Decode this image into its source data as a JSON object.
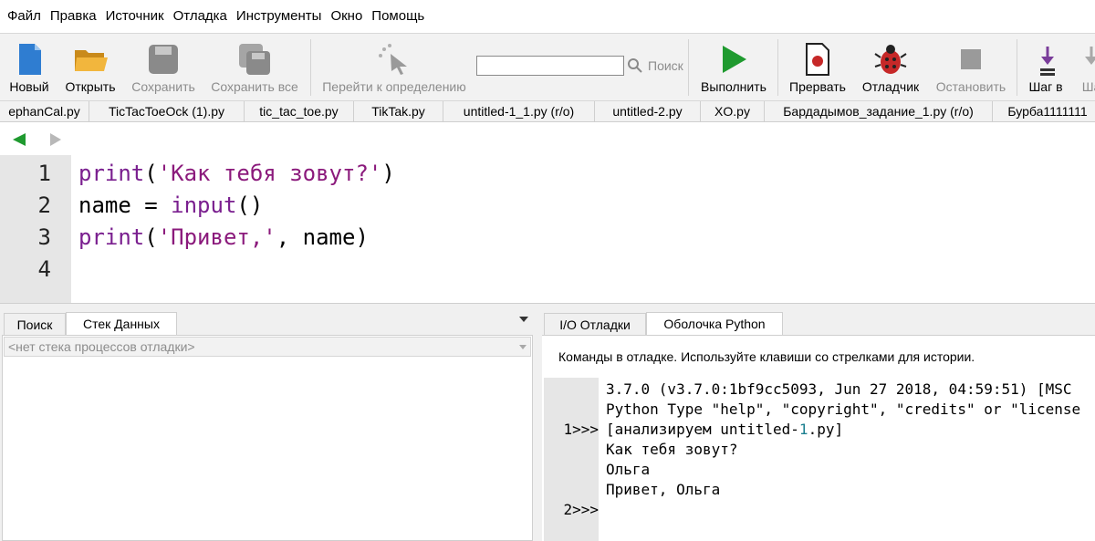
{
  "menu": [
    "Файл",
    "Правка",
    "Источник",
    "Отладка",
    "Инструменты",
    "Окно",
    "Помощь"
  ],
  "toolbar": {
    "new": "Новый",
    "open": "Открыть",
    "save": "Сохранить",
    "save_all": "Сохранить все",
    "goto_def": "Перейти к определению",
    "search_value": "",
    "search_label": "Поиск",
    "run": "Выполнить",
    "break": "Прервать",
    "debugger": "Отладчик",
    "stop": "Остановить",
    "step": "Шаг в",
    "step_over_partial": "Ша"
  },
  "file_tabs": [
    "ephanCal.py",
    "TicTacToeOck (1).py",
    "tic_tac_toe.py",
    "TikTak.py",
    "untitled-1_1.py (r/o)",
    "untitled-2.py",
    "XO.py",
    "Бардадымов_задание_1.py (r/o)",
    "Бурба1111111"
  ],
  "editor": {
    "line_numbers": [
      "1",
      "2",
      "3",
      "4"
    ],
    "lines": [
      {
        "kw": "print",
        "p1": "(",
        "str": "'Как тебя зовут?'",
        "p2": ")"
      },
      {
        "name": "name = ",
        "kw": "input",
        "p": "()"
      },
      {
        "kw": "print",
        "p1": "(",
        "str": "'Привет,'",
        "p2": ", name)"
      },
      {}
    ]
  },
  "left_pane": {
    "tabs": [
      "Поиск",
      "Стек Данных"
    ],
    "active_tab": "Стек Данных",
    "stack_placeholder": "<нет стека процессов отладки>"
  },
  "right_pane": {
    "tabs": [
      "I/O Отладки",
      "Оболочка Python"
    ],
    "active_tab": "Оболочка Python",
    "hint": "Команды в отладке.  Используйте клавиши со стрелками для истории.",
    "shell": {
      "line1": "3.7.0 (v3.7.0:1bf9cc5093, Jun 27 2018, 04:59:51) [MSC",
      "line2": "Python Type \"help\", \"copyright\", \"credits\" or \"license",
      "line3_a": "[анализируем untitled-",
      "line3_num": "1",
      "line3_b": ".py]",
      "line4": "Как тебя зовут?",
      "line5": "Ольга",
      "line6": "Привет, Ольга",
      "prompt1": "1>>>",
      "prompt2": "2>>>"
    }
  },
  "colors": {
    "keyword": "#7a1f8f",
    "string": "#8b1a7c",
    "run_green": "#1f9a2f",
    "debug_red": "#c62828"
  }
}
